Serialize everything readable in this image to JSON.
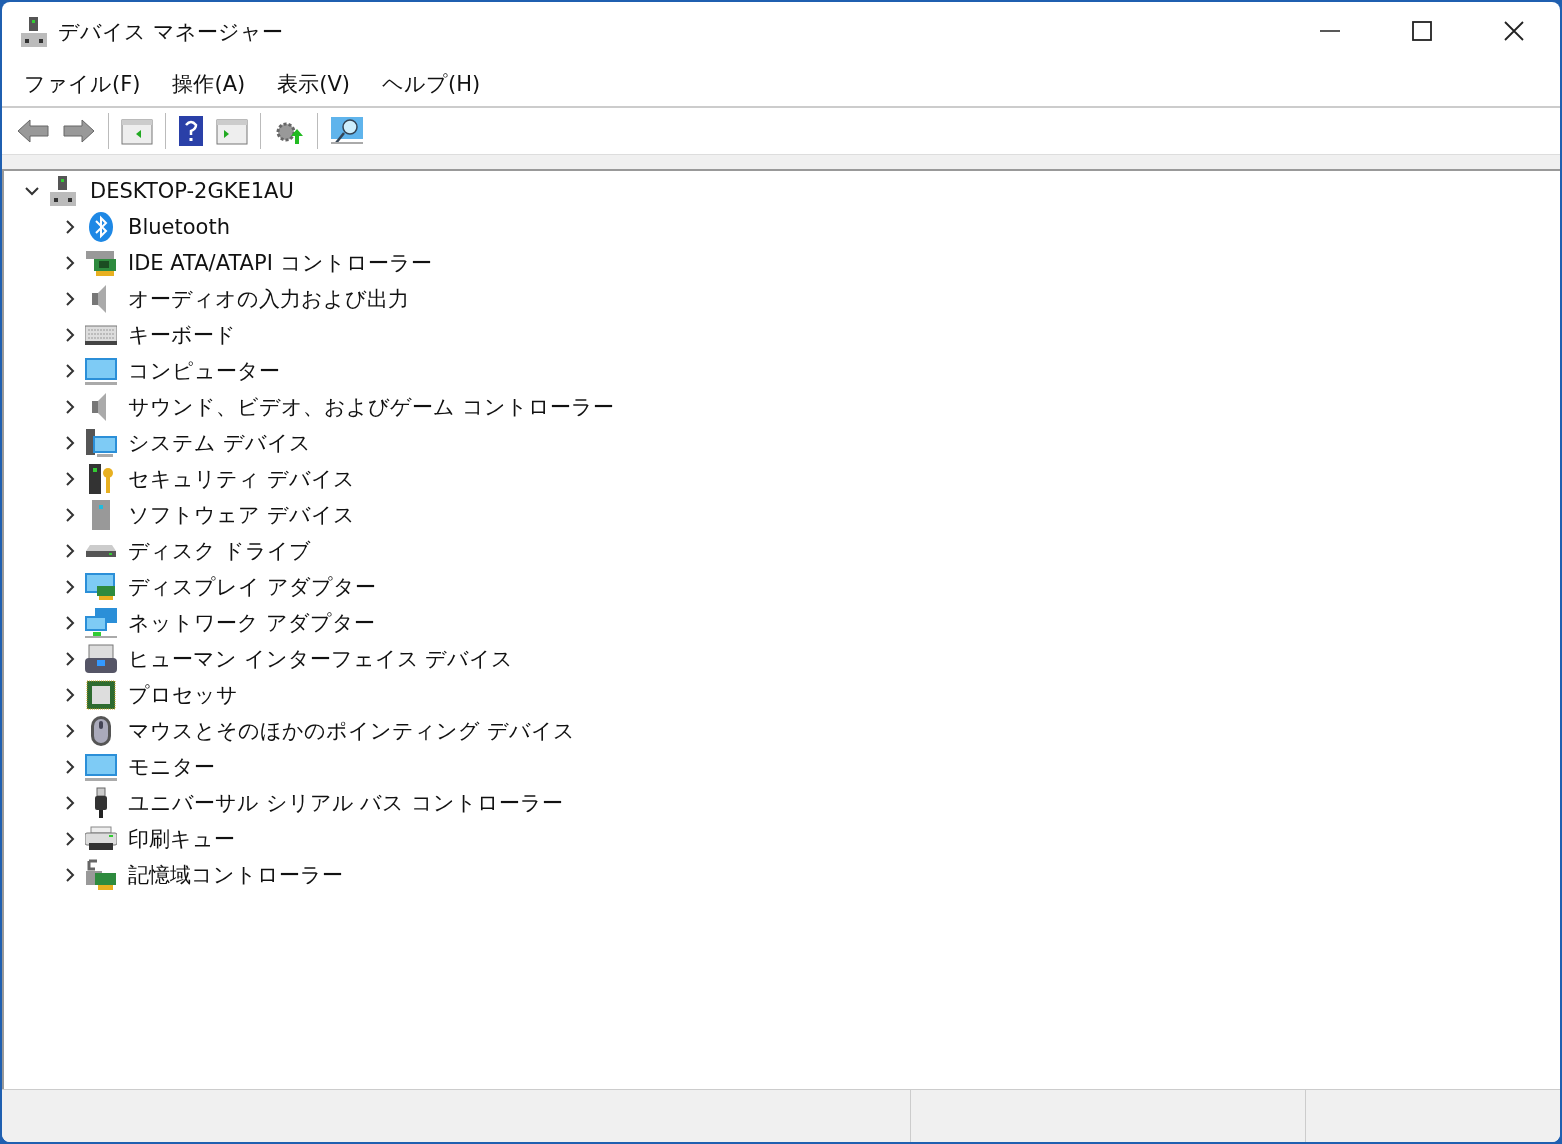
{
  "window": {
    "title": "デバイス マネージャー"
  },
  "menu": [
    {
      "label": "ファイル(F)"
    },
    {
      "label": "操作(A)"
    },
    {
      "label": "表示(V)"
    },
    {
      "label": "ヘルプ(H)"
    }
  ],
  "tree": {
    "label": "DESKTOP-2GKE1AU",
    "expanded": true,
    "children": [
      {
        "label": "Bluetooth",
        "expanded": false
      },
      {
        "label": "IDE ATA/ATAPI コントローラー",
        "expanded": false
      },
      {
        "label": "オーディオの入力および出力",
        "expanded": false
      },
      {
        "label": "キーボード",
        "expanded": false
      },
      {
        "label": "コンピューター",
        "expanded": false
      },
      {
        "label": "サウンド、ビデオ、およびゲーム コントローラー",
        "expanded": false
      },
      {
        "label": "システム デバイス",
        "expanded": false
      },
      {
        "label": "セキュリティ デバイス",
        "expanded": false
      },
      {
        "label": "ソフトウェア デバイス",
        "expanded": false
      },
      {
        "label": "ディスク ドライブ",
        "expanded": false
      },
      {
        "label": "ディスプレイ アダプター",
        "expanded": false
      },
      {
        "label": "ネットワーク アダプター",
        "expanded": false
      },
      {
        "label": "ヒューマン インターフェイス デバイス",
        "expanded": false
      },
      {
        "label": "プロセッサ",
        "expanded": false
      },
      {
        "label": "マウスとそのほかのポインティング デバイス",
        "expanded": false
      },
      {
        "label": "モニター",
        "expanded": false
      },
      {
        "label": "ユニバーサル シリアル バス コントローラー",
        "expanded": false
      },
      {
        "label": "印刷キュー",
        "expanded": false
      },
      {
        "label": "記憶域コントローラー",
        "expanded": false
      }
    ]
  }
}
